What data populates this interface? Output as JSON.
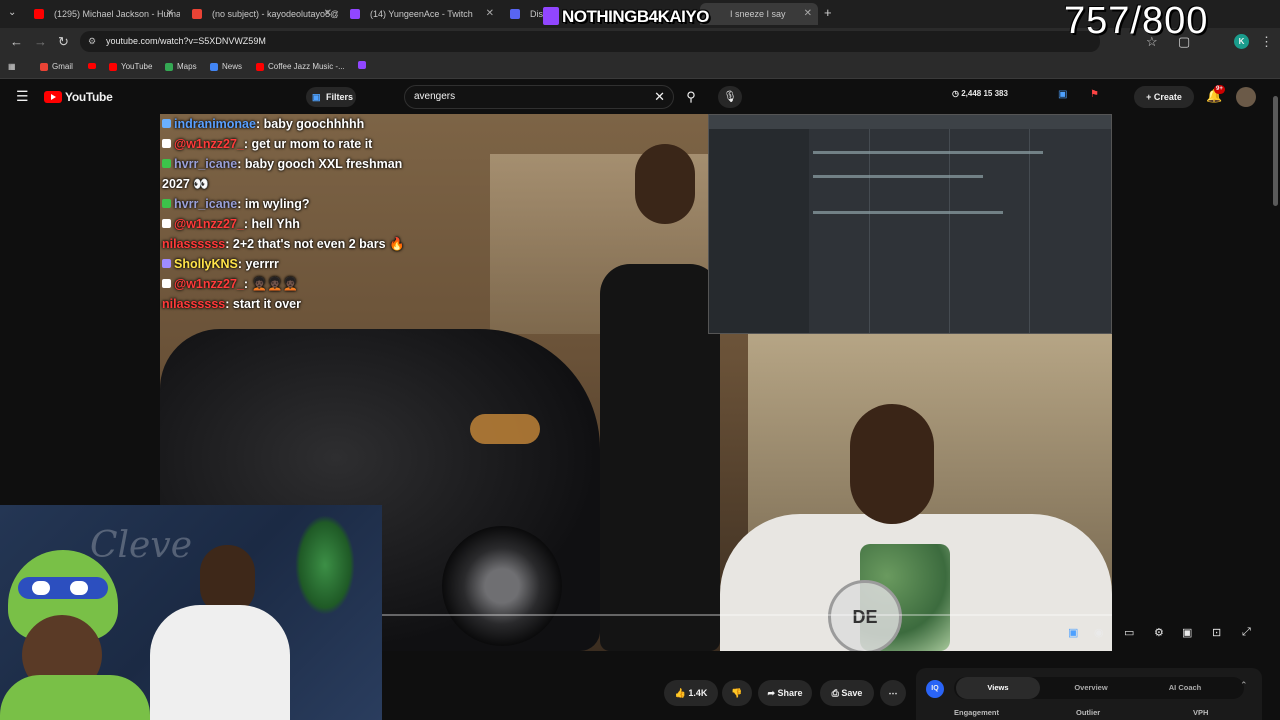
{
  "browser": {
    "tabs": [
      {
        "label": "(1295) Michael Jackson - Huma",
        "color": "#ff0000"
      },
      {
        "label": "(no subject) - kayodeolutayo5@",
        "color": "#ea4335"
      },
      {
        "label": "(14) YungeenAce - Twitch",
        "color": "#9146ff"
      },
      {
        "label": "Disc",
        "color": "#5865f2"
      },
      {
        "label": "I sneeze I say",
        "color": "#ff0000"
      }
    ],
    "url": "youtube.com/watch?v=S5XDNVWZ59M",
    "bookmarks": [
      {
        "label": "Gmail",
        "color": "#ea4335"
      },
      {
        "label": "YouTube",
        "color": "#ff0000"
      },
      {
        "label": "Maps",
        "color": "#34a853"
      },
      {
        "label": "News",
        "color": "#4285f4"
      },
      {
        "label": "Coffee Jazz Music -...",
        "color": "#ff0000"
      }
    ],
    "profile_initial": "K"
  },
  "youtube": {
    "logo": "YouTube",
    "filters_label": "Filters",
    "search_value": "avengers",
    "stats": "2,448  15  383",
    "create_label": "Create",
    "notification_badge": "9+"
  },
  "chat": [
    {
      "user": "indranimonae",
      "message": "baby goochhhhh",
      "user_color": "#5aa0ff",
      "badge_color": "#6ab0ff"
    },
    {
      "user": "@w1nzz27_",
      "message": "get ur mom to rate it",
      "user_color": "#ff3a3a",
      "badge_color": "#ffffff"
    },
    {
      "user": "hvrr_icane",
      "message": "baby gooch XXL freshman 2027 👀",
      "user_color": "#9aa0d8",
      "badge_color": "#3cc34a"
    },
    {
      "user": "hvrr_icane",
      "message": "im wyling?",
      "user_color": "#9aa0d8",
      "badge_color": "#3cc34a"
    },
    {
      "user": "@w1nzz27_",
      "message": "hell Yhh",
      "user_color": "#ff3a3a",
      "badge_color": "#ffffff"
    },
    {
      "user": "nilassssss",
      "message": "2+2 that's not even 2 bars 🔥",
      "user_color": "#ff3a3a",
      "badge_color": ""
    },
    {
      "user": "ShollyKNS",
      "message": "yerrrr",
      "user_color": "#ffe34a",
      "badge_color": "#9f8cff"
    },
    {
      "user": "@w1nzz27_",
      "message": "🧑🏿‍🦱🧑🏿‍🦱🧑🏿‍🦱",
      "user_color": "#ff3a3a",
      "badge_color": "#ffffff"
    },
    {
      "user": "nilassssss",
      "message": "start it over",
      "user_color": "#ff3a3a",
      "badge_color": ""
    }
  ],
  "overlay": {
    "streamer_name": "NOTHINGB4KAIYO",
    "counter": "757/800",
    "webcam_sign": "Cleve",
    "watermark": "DE"
  },
  "video": {
    "progress_fraction": 0.003
  },
  "actions": {
    "like_count": "1.4K",
    "share_label": "Share",
    "save_label": "Save"
  },
  "panel": {
    "logo": "IQ",
    "tabs": [
      "Views",
      "Overview",
      "AI Coach"
    ],
    "active_tab": "Views",
    "columns": [
      "Engagement",
      "Outlier",
      "VPH"
    ]
  }
}
